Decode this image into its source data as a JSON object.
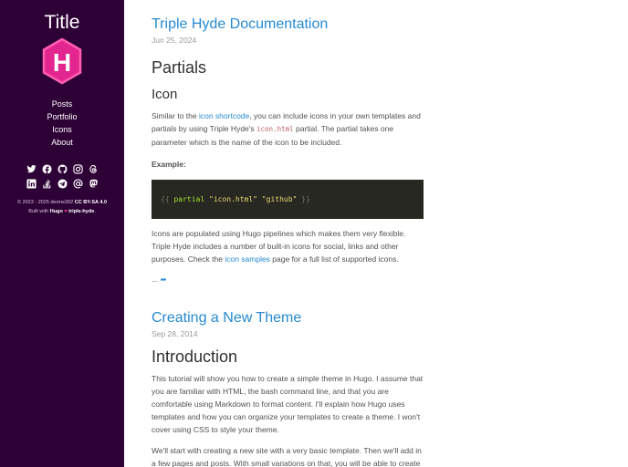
{
  "sidebar": {
    "title": "Title",
    "logo_letter": "H",
    "nav": [
      "Posts",
      "Portfolio",
      "Icons",
      "About"
    ],
    "social_icons": [
      "twitter-icon",
      "facebook-icon",
      "github-icon",
      "instagram-icon",
      "threads-icon",
      "linkedin-icon",
      "stackoverflow-icon",
      "telegram-icon",
      "email-icon",
      "mastodon-icon"
    ],
    "copyright_prefix": "© 2023 - 2025 derme302",
    "license": "CC BY-SA 4.0",
    "built_prefix": "Built with",
    "built_hugo": "Hugo",
    "built_heart": "♥",
    "built_theme": "triple-hyde",
    "built_suffix": "."
  },
  "posts": [
    {
      "title": "Triple Hyde Documentation",
      "date": "Jun 25, 2024",
      "h2": "Partials",
      "h3": "Icon",
      "p1_a": "Similar to the ",
      "p1_link": "icon shortcode",
      "p1_b": ", you can include icons in your own templates and partials by using Triple Hyde's ",
      "p1_code": "icon.html",
      "p1_c": " partial. The partial takes one parameter which is the name of the icon to be included.",
      "example_label": "Example:",
      "code_open": "{{",
      "code_fn": "partial",
      "code_args": "\"icon.html\" \"github\"",
      "code_close": "}}",
      "p2_a": "Icons are populated using Hugo pipelines which makes them very flexible. Triple Hyde includes a number of built-in icons for social, links and other purposes. Check the ",
      "p2_link": "icon samples",
      "p2_b": " page for a full list of supported icons.",
      "more": "...",
      "more_arrow": "➦"
    },
    {
      "title": "Creating a New Theme",
      "date": "Sep 28, 2014",
      "h2": "Introduction",
      "p1": "This tutorial will show you how to create a simple theme in Hugo. I assume that you are familiar with HTML, the bash command line, and that you are comfortable using Markdown to format content. I'll explain how Hugo uses templates and how you can organize your templates to create a theme. I won't cover using CSS to style your theme.",
      "p2": "We'll start with creating a new site with a very basic template. Then we'll add in a few pages and posts. With small variations on that, you will be able to create"
    }
  ]
}
